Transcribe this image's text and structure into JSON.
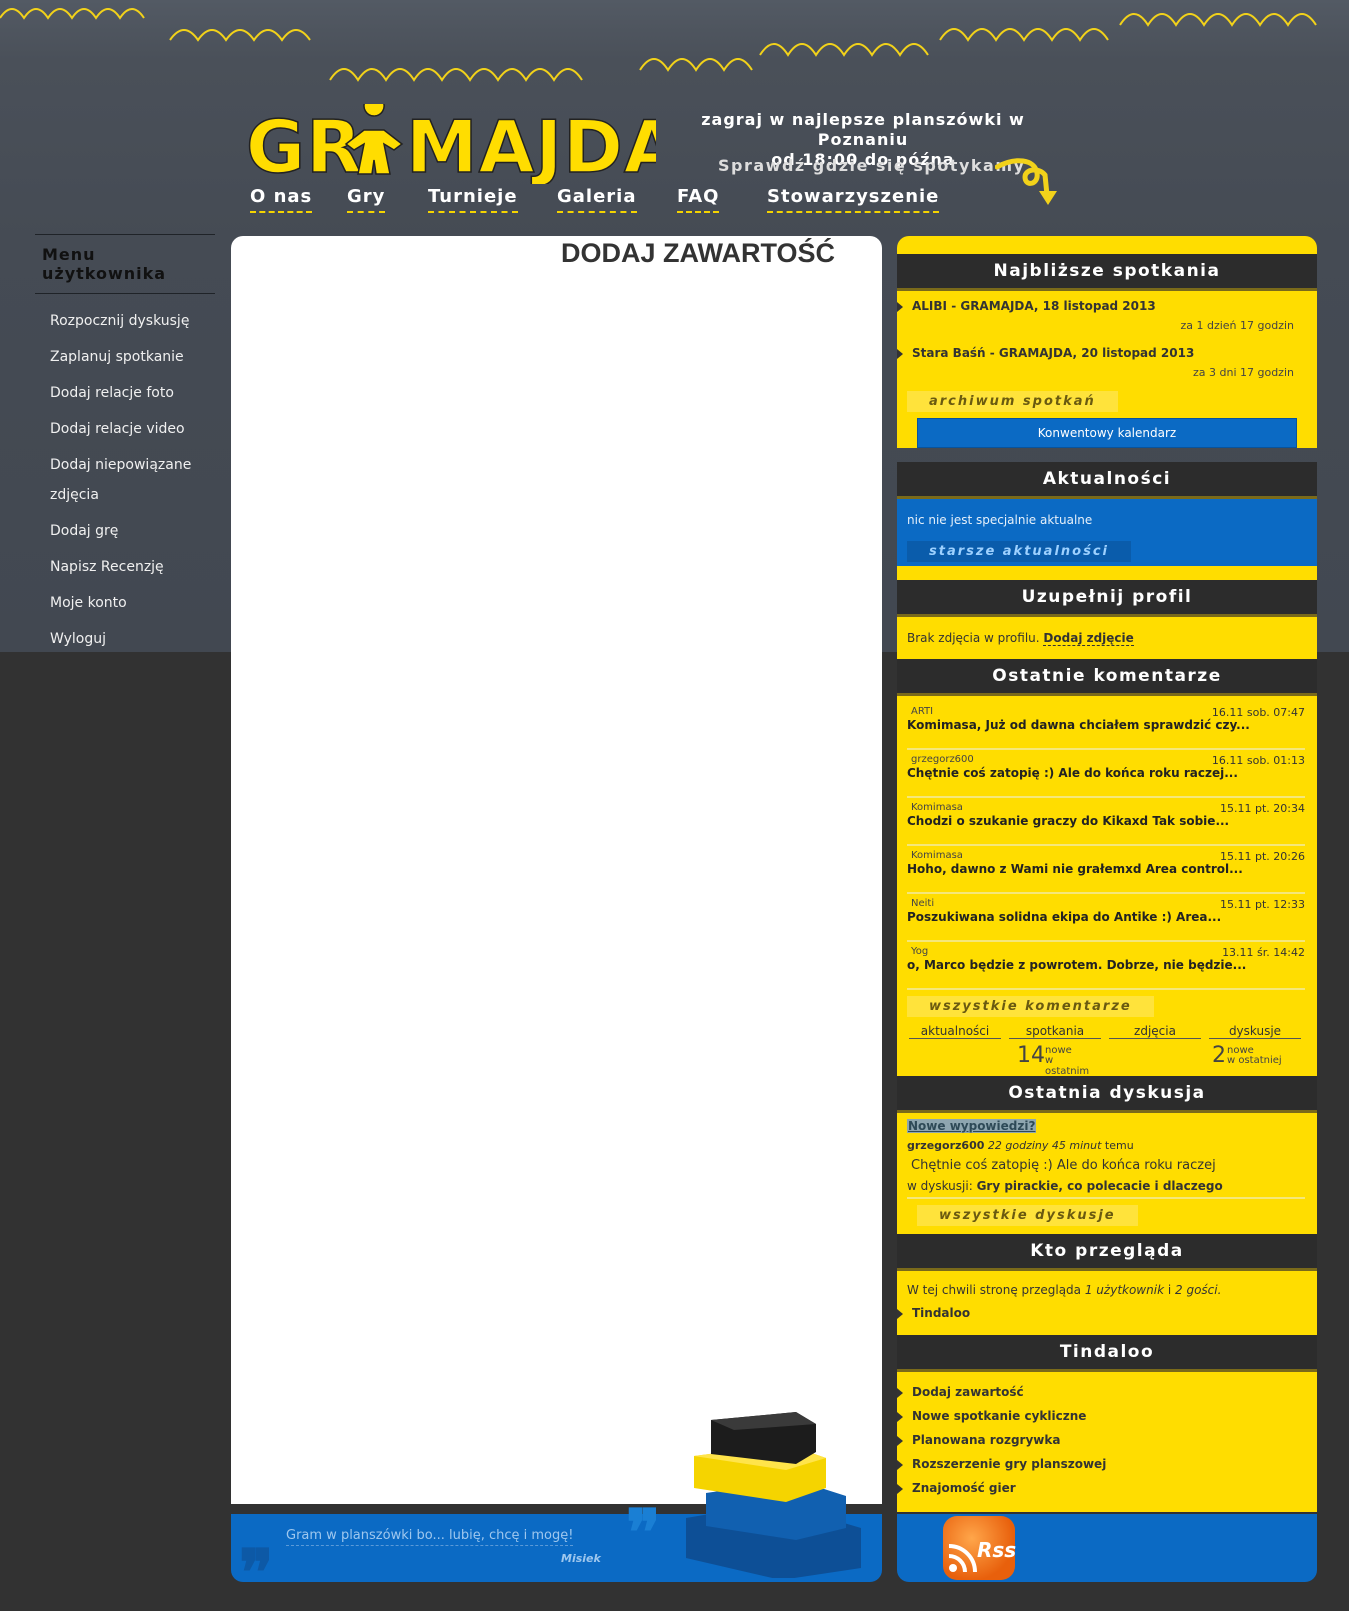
{
  "header": {
    "logo_text": "GRAMAJDA",
    "tagline_line1": "zagraj w najlepsze planszówki w Poznaniu",
    "tagline_line2": "od 18:00 do późna",
    "where_text": "Sprawdź gdzie się spotykamy",
    "nav": [
      "O nas",
      "Gry",
      "Turnieje",
      "Galeria",
      "FAQ",
      "Stowarzyszenie"
    ]
  },
  "user_menu": {
    "title": "Menu użytkownika",
    "items": [
      "Rozpocznij dyskusję",
      "Zaplanuj spotkanie",
      "Dodaj relacje foto",
      "Dodaj relacje video",
      "Dodaj niepowiązane zdjęcia",
      "Dodaj grę",
      "Napisz Recenzję",
      "Moje konto",
      "Wyloguj"
    ]
  },
  "content": {
    "title": "DODAJ ZAWARTOŚĆ"
  },
  "quote": {
    "text": "Gram w planszówki bo... lubię, chcę i mogę!",
    "author": "Misiek"
  },
  "meetings": {
    "title": "Najbliższe spotkania",
    "events": [
      {
        "name": "ALIBI - GRAMAJDA, 18 listopad 2013",
        "when": "za 1 dzień 17 godzin"
      },
      {
        "name": "Stara Baśń - GRAMAJDA, 20 listopad 2013",
        "when": "za 3 dni 17 godzin"
      }
    ],
    "archive_label": "archiwum spotkań",
    "calendar_button": "Konwentowy kalendarz"
  },
  "news": {
    "title": "Aktualności",
    "text": "nic nie jest specjalnie aktualne",
    "older_label": "starsze aktualności"
  },
  "profile": {
    "title": "Uzupełnij profil",
    "text": "Brak zdjęcia w profilu.",
    "link": "Dodaj zdjęcie"
  },
  "comments": {
    "title": "Ostatnie komentarze",
    "items": [
      {
        "author": "ARTI",
        "date": "16.11 sob. 07:47",
        "text": "Komimasa, Już od dawna chciałem sprawdzić czy..."
      },
      {
        "author": "grzegorz600",
        "date": "16.11 sob. 01:13",
        "text": "Chętnie coś zatopię :) Ale do końca roku raczej..."
      },
      {
        "author": "Komimasa",
        "date": "15.11 pt. 20:34",
        "text": "Chodzi o szukanie graczy do Kikaxd Tak sobie..."
      },
      {
        "author": "Komimasa",
        "date": "15.11 pt. 20:26",
        "text": "Hoho, dawno z Wami nie grałemxd Area control..."
      },
      {
        "author": "Neiti",
        "date": "15.11 pt. 12:33",
        "text": "Poszukiwana solidna ekipa do Antike :) Area..."
      },
      {
        "author": "Yog",
        "date": "13.11 śr. 14:42",
        "text": "o, Marco będzie z powrotem. Dobrze, nie będzie..."
      }
    ],
    "all_label": "wszystkie komentarze",
    "stats": {
      "labels": [
        "aktualności",
        "spotkania",
        "zdjęcia",
        "dyskusje"
      ],
      "spotkania_count": "14",
      "spotkania_note_1": "nowe",
      "spotkania_note_2": "w",
      "spotkania_note_3": "ostatnim",
      "dyskusje_count": "2",
      "dyskusje_note_1": "nowe",
      "dyskusje_note_2": "w ostatniej"
    }
  },
  "last_discussion": {
    "title": "Ostatnia dyskusja",
    "badge": "Nowe wypowiedzi?",
    "author": "grzegorz600",
    "time_ago": "22 godziny 45 minut",
    "time_suffix": "temu",
    "excerpt": "Chętnie coś zatopię :) Ale do końca roku raczej",
    "in_label": "w dyskusji:",
    "topic": "Gry pirackie, co polecacie i dlaczego",
    "all_label": "wszystkie dyskusje"
  },
  "who_online": {
    "title": "Kto przegląda",
    "text_prefix": "W tej chwili stronę przegląda",
    "users": "1 użytkownik",
    "and": "i",
    "guests": "2 gości.",
    "user_name": "Tindaloo"
  },
  "user_links": {
    "title": "Tindaloo",
    "items": [
      "Dodaj zawartość",
      "Nowe spotkanie cykliczne",
      "Planowana rozgrywka",
      "Rozszerzenie gry planszowej",
      "Znajomość gier"
    ]
  },
  "footer": {
    "rss_label": "Rss"
  }
}
